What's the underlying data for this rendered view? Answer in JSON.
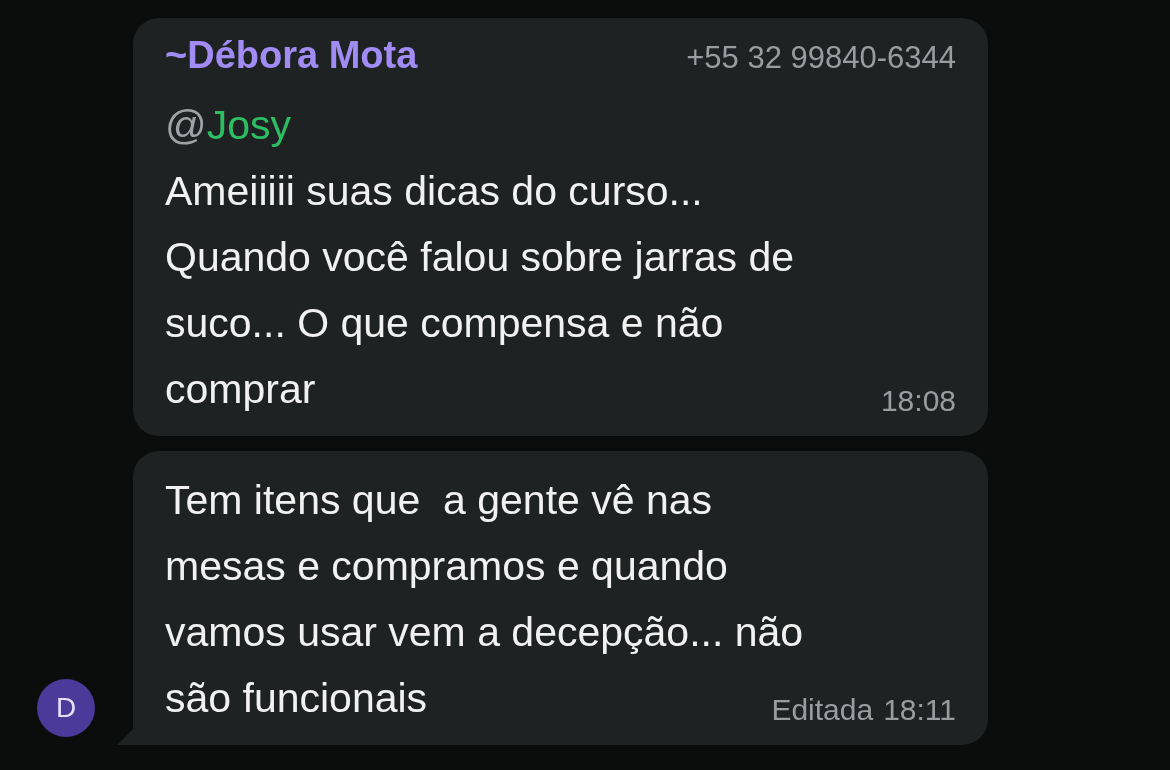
{
  "messages": [
    {
      "sender": {
        "prefix": "~",
        "name": "Débora Mota",
        "phone": "+55 32 99840-6344"
      },
      "mention": {
        "at": "@",
        "name": "Josy"
      },
      "lines": [
        "Ameiiiii suas dicas do curso...",
        "Quando você falou sobre jarras de",
        "suco... O que compensa e não",
        "comprar"
      ],
      "time": "18:08"
    },
    {
      "lines": [
        "Tem itens que  a gente vê nas",
        "mesas e compramos e quando",
        "vamos usar vem a decepção... não",
        "são funcionais"
      ],
      "edited_label": "Editada",
      "time": "18:11"
    }
  ],
  "avatar": {
    "initial": "D"
  }
}
